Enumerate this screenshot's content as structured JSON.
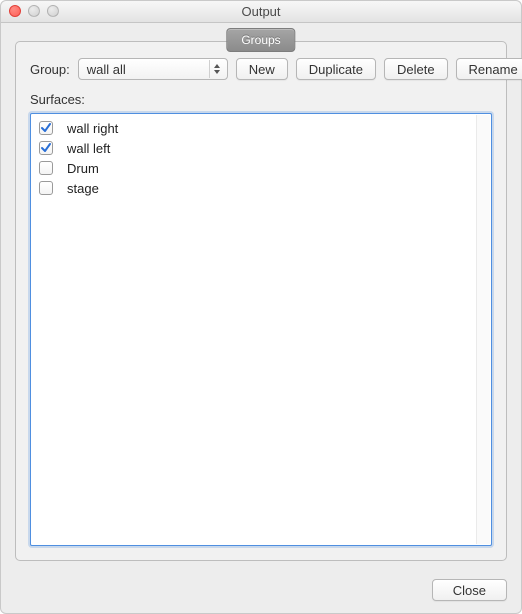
{
  "window": {
    "title": "Output"
  },
  "tab": {
    "label": "Groups"
  },
  "group": {
    "label": "Group:",
    "selected": "wall all"
  },
  "buttons": {
    "new": "New",
    "duplicate": "Duplicate",
    "delete": "Delete",
    "rename": "Rename",
    "close": "Close"
  },
  "surfaces": {
    "label": "Surfaces:",
    "items": [
      {
        "label": "wall right",
        "checked": true
      },
      {
        "label": "wall left",
        "checked": true
      },
      {
        "label": "Drum",
        "checked": false
      },
      {
        "label": "stage",
        "checked": false
      }
    ]
  }
}
